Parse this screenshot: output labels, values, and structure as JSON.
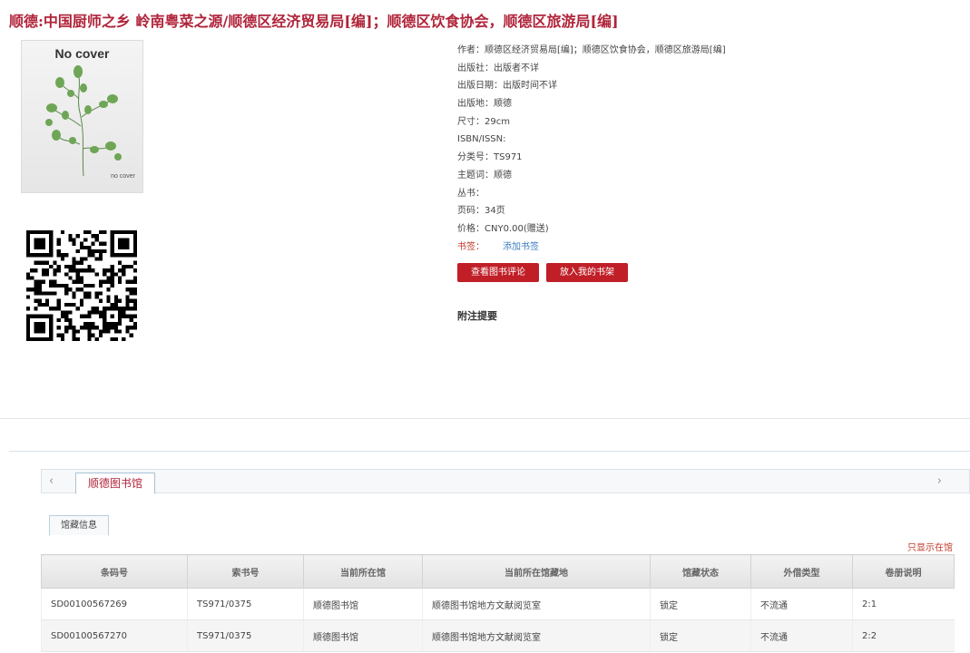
{
  "book": {
    "title": "顺德:中国厨师之乡 岭南粤菜之源/顺德区经济贸易局[编]；顺德区饮食协会，顺德区旅游局[编]",
    "cover_text_large": "No cover",
    "cover_text_small": "no cover"
  },
  "meta": {
    "author": "作者：顺德区经济贸易局[编]；顺德区饮食协会，顺德区旅游局[编]",
    "publisher": "出版社：出版者不详",
    "pub_date": "出版日期：出版时间不详",
    "pub_place": "出版地：顺德",
    "size": "尺寸：29cm",
    "isbn": "ISBN/ISSN:",
    "class_no": "分类号：TS971",
    "subject": "主题词：顺德",
    "series": "丛书：",
    "pages": "页码：34页",
    "price": "价格：CNY0.00(赠送)",
    "bookmark_label": "书签：",
    "bookmark_link": "添加书签"
  },
  "actions": {
    "reviews": "查看图书评论",
    "shelf": "放入我的书架"
  },
  "notes_heading": "附注提要",
  "tabs": {
    "library": "顺德图书馆",
    "holding_info": "馆藏信息",
    "left_arrow": "‹",
    "right_arrow": "›"
  },
  "show_only": "只显示在馆",
  "holdings": {
    "columns": [
      "条码号",
      "索书号",
      "当前所在馆",
      "当前所在馆藏地",
      "馆藏状态",
      "外借类型",
      "卷册说明"
    ],
    "rows": [
      [
        "SD00100567269",
        "TS971/0375",
        "顺德图书馆",
        "顺德图书馆地方文献阅览室",
        "锁定",
        "不流通",
        "2:1"
      ],
      [
        "SD00100567270",
        "TS971/0375",
        "顺德图书馆",
        "顺德图书馆地方文献阅览室",
        "锁定",
        "不流通",
        "2:2"
      ]
    ]
  },
  "colors": {
    "accent": "#b0243a",
    "button": "#c01f27",
    "link": "#3d7ec0"
  }
}
